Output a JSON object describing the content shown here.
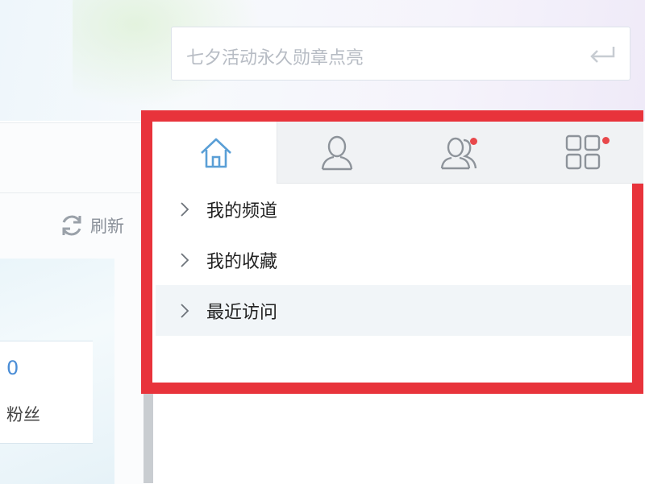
{
  "search": {
    "placeholder": "七夕活动永久勋章点亮"
  },
  "left": {
    "refresh_label": "刷新",
    "fans_count": "0",
    "fans_label": "粉丝"
  },
  "tabs": [
    {
      "icon": "home-icon",
      "active": true
    },
    {
      "icon": "user-icon",
      "active": false
    },
    {
      "icon": "friends-icon",
      "active": false,
      "badge": true
    },
    {
      "icon": "apps-grid-icon",
      "active": false,
      "badge": true
    }
  ],
  "menu": [
    {
      "label": "我的频道"
    },
    {
      "label": "我的收藏"
    },
    {
      "label": "最近访问"
    }
  ],
  "colors": {
    "highlight": "#e8333b",
    "accent": "#5a9fd6",
    "badge": "#e8484b"
  }
}
